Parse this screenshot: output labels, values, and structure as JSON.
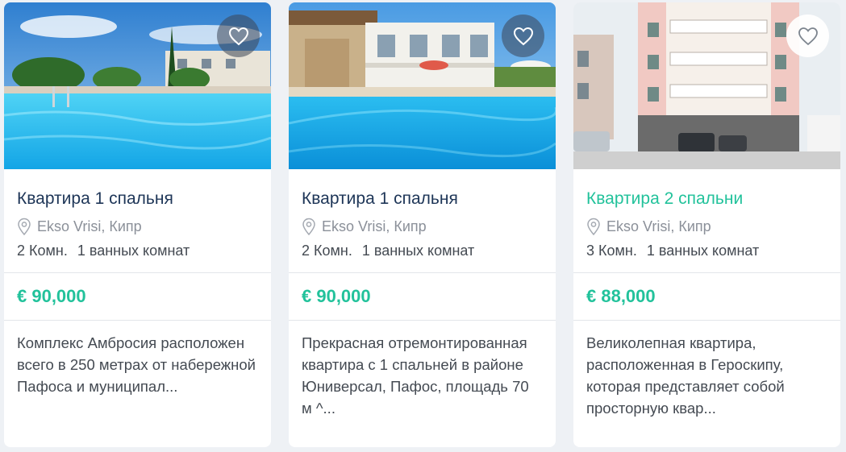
{
  "listings": [
    {
      "title": "Квартира 1 спальня",
      "location": "Ekso Vrisi, Кипр",
      "rooms": "2 Комн.",
      "baths": "1 ванных комнат",
      "price": "€ 90,000",
      "description": "Комплекс  Амбросия расположен всего в 250 метрах от набережной  Пафоса и муниципал...",
      "favorite_icon": "heart-icon",
      "highlighted": false
    },
    {
      "title": "Квартира 1 спальня",
      "location": "Ekso Vrisi, Кипр",
      "rooms": "2 Комн.",
      "baths": "1 ванных комнат",
      "price": "€ 90,000",
      "description": "Прекрасная отремонтированная квартира с 1 спальней в районе Юниверсал, Пафос, площадь 70 м ^...",
      "favorite_icon": "heart-icon",
      "highlighted": false
    },
    {
      "title": "Квартира 2 спальни",
      "location": "Ekso Vrisi, Кипр",
      "rooms": "3 Комн.",
      "baths": "1 ванных комнат",
      "price": "€ 88,000",
      "description": "Великолепная квартира, расположенная в Героскипу, которая представляет собой просторную квар...",
      "favorite_icon": "heart-icon",
      "highlighted": true
    }
  ],
  "colors": {
    "accent": "#22c29b",
    "title": "#1d3557",
    "muted": "#8b9099",
    "text": "#444a52",
    "background": "#eef1f5"
  }
}
